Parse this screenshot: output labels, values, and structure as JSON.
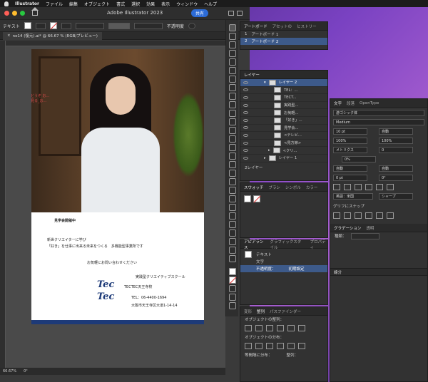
{
  "menubar": {
    "app": "Illustrator",
    "items": [
      "ファイル",
      "編集",
      "オブジェクト",
      "書式",
      "選択",
      "効果",
      "表示",
      "ウィンドウ",
      "ヘルプ"
    ]
  },
  "window": {
    "title": "Adobe Illustrator 2023",
    "share_label": "共有"
  },
  "control": {
    "label": "テキスト",
    "opacity_label": "不透明度"
  },
  "doc_tab": {
    "label": "no14 (復元).ai* @ 66.67 % (RGB/プレビュー)"
  },
  "artboard": {
    "sel_text_1": "どうぞ お...",
    "sel_text_2": "見る_お...",
    "line1": "見学会開催中",
    "line2": "新世クリエイターに学び",
    "line3": "「好き」を仕事に出来る未来をつくる　多機能型事業所です",
    "line4": "お気軽にお問い合わせください",
    "school": "実践型クリエイティブスクール",
    "campus": "TECTEC天王寺校",
    "tel": "TEL：06-4400-1694",
    "address": "大阪市天王寺区大道1-14-14",
    "logo_top": "Tec",
    "logo_bottom": "Tec"
  },
  "status": {
    "zoom": "66.67%",
    "angle": "0°"
  },
  "artboards_panel": {
    "tabs": [
      "アートボード",
      "アセットの",
      "ヒストリー"
    ],
    "rows": [
      {
        "num": "1",
        "name": "アートボード 1"
      },
      {
        "num": "2",
        "name": "アートボード 2"
      }
    ]
  },
  "layers_panel": {
    "tab": "レイヤー",
    "rows": [
      "レイヤー 2",
      "TEL：...",
      "TECT...",
      "実践型...",
      "お気軽...",
      "「好き」...",
      "見学会...",
      "<テレビ...",
      "<見方節>",
      "<クリ...",
      "レイヤー 1"
    ],
    "footer": "2レイヤー"
  },
  "swatches_panel": {
    "tabs": [
      "スウォッチ",
      "ブラシ",
      "シンボル",
      "カラー"
    ]
  },
  "appearance_panel": {
    "tabs": [
      "アピアランス",
      "グラフィックスタイル",
      "プロパティ"
    ],
    "rows": [
      "テキスト",
      "文字",
      "不透明度：",
      "初期設定"
    ]
  },
  "transform_panel": {
    "tabs": [
      "変形",
      "整列",
      "パスファインダー"
    ],
    "align_objects": "オブジェクトの整列：",
    "distribute_objects": "オブジェクトの分布：",
    "distribute_spacing": "等間隔に分布：",
    "align_to": "整列："
  },
  "character_panel": {
    "tabs": [
      "文字",
      "段落",
      "OpenType"
    ],
    "font": "游ゴシック体",
    "weight": "Medium",
    "size": "10 pt",
    "leading": "自動",
    "hscale": "100%",
    "vscale": "100%",
    "kerning": "メトリクス",
    "tracking": "0",
    "tsume": "0%",
    "auto1": "自動",
    "auto2": "自動",
    "baseline": "0 pt",
    "rotate": "0°",
    "language": "英語：米国",
    "aa": "シャープ",
    "snap_label": "グリフにスナップ"
  },
  "gradient_panel": {
    "tabs": [
      "グラデーション",
      "透明"
    ],
    "type_label": "種類：",
    "section": "線分"
  }
}
